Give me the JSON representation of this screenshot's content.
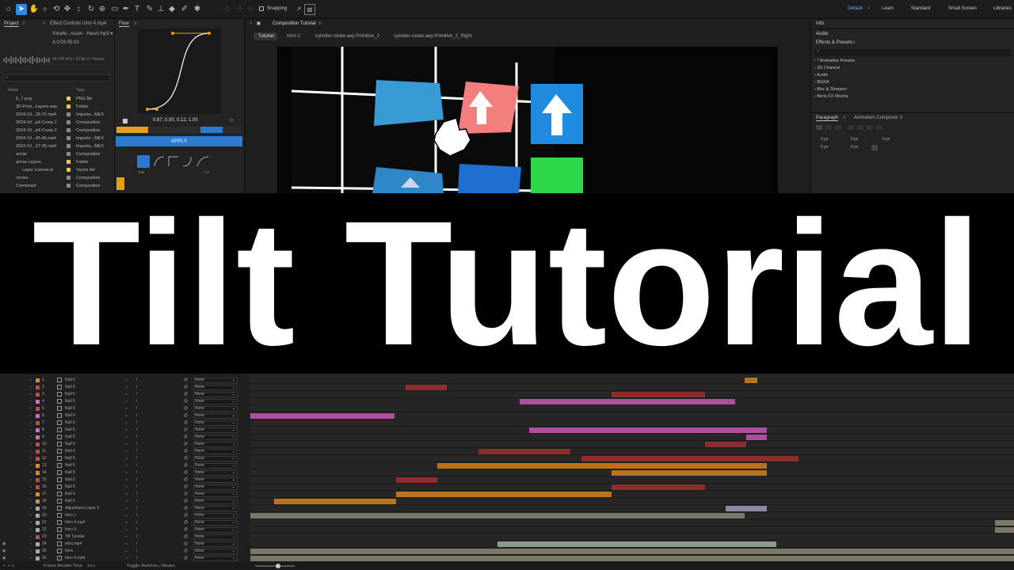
{
  "toolbar": {
    "snapping_label": "Snapping",
    "workspaces": [
      "Default",
      "Learn",
      "Standard",
      "Small Screen",
      "Libraries"
    ]
  },
  "project": {
    "tab": "Project",
    "effect_tab": "Effect Controls Intro 4.mp4",
    "file_line1": "Xxtarki...rozen - Heart.mp3 ▾",
    "file_line2": "Δ 0:03:05:03",
    "audio_info": "44,100 kHz / 32 bit U / Stereo",
    "col_name": "Name",
    "col_type": "Type",
    "items": [
      {
        "name": "5_7.png",
        "type": "PNG file",
        "color": "#e6c84a"
      },
      {
        "name": "3D-Prim...Layers.aep",
        "type": "Folder",
        "color": "#e6c84a"
      },
      {
        "name": "2024-10...38-37.mp4",
        "type": "Importe...MEX",
        "color": "#8a8a8a"
      },
      {
        "name": "2024-10...p4 Comp 1",
        "type": "Composition",
        "color": "#8a8a8a"
      },
      {
        "name": "2024-10...p4 Comp 2",
        "type": "Composition",
        "color": "#8a8a8a"
      },
      {
        "name": "2024-10...45-46.mp4",
        "type": "Importe...MEX",
        "color": "#8a8a8a"
      },
      {
        "name": "2024-10...27-35.mp4",
        "type": "Importe...MEX",
        "color": "#8a8a8a"
      },
      {
        "name": "arrow",
        "type": "Composition",
        "color": "#8a8a8a"
      },
      {
        "name": "arrow Layers",
        "type": "Folder",
        "color": "#e6c84a"
      },
      {
        "name": "Layer 1/arrow.ai",
        "type": "Vector Art",
        "color": "#e6c84a"
      },
      {
        "name": "circles",
        "type": "Composition",
        "color": "#8a8a8a"
      },
      {
        "name": "Combined",
        "type": "Composition",
        "color": "#8a8a8a"
      }
    ]
  },
  "flow": {
    "tab": "Flow",
    "values": "0.87, 0.00, 0.12, 1.00",
    "apply_label": "APPLY",
    "preset_labels": [
      "fast",
      "fast"
    ]
  },
  "composition": {
    "tab": "Composition Tutorial",
    "breadcrumbs": [
      "Tutorial",
      "Intro 2",
      "cylinder-rotate.aep.Primitive_2",
      "cylinder-rotate.aep.Primitive_2_Right"
    ]
  },
  "right": {
    "info_tab": "Info",
    "audio_tab": "Audio",
    "effects_tab": "Effects & Presets",
    "presets": [
      "* Animation Presets",
      "3D Channel",
      "Audio",
      "BGRA",
      "Blur & Sharpen",
      "Boris FX Mocha"
    ],
    "paragraph_tab": "Paragraph",
    "composer_tab": "Animation Composer 3",
    "px_values": [
      "0 px",
      "0 px",
      "0 px",
      "0 px",
      "0 px"
    ]
  },
  "title": {
    "text": "Tilt Tutorial"
  },
  "timeline": {
    "mode_default": "None",
    "layers": [
      {
        "num": "1",
        "name": "Null 6",
        "color": "#e08a2a"
      },
      {
        "num": "2",
        "name": "Null 6",
        "color": "#c84848"
      },
      {
        "num": "3",
        "name": "Null 6",
        "color": "#c84848"
      },
      {
        "num": "4",
        "name": "Null 6",
        "color": "#d868c8"
      },
      {
        "num": "5",
        "name": "Null 6",
        "color": "#c84848"
      },
      {
        "num": "6",
        "name": "Null 6",
        "color": "#d868c8"
      },
      {
        "num": "7",
        "name": "Null 6",
        "color": "#c84848"
      },
      {
        "num": "8",
        "name": "Null 6",
        "color": "#d868c8"
      },
      {
        "num": "9",
        "name": "Null 6",
        "color": "#d868c8"
      },
      {
        "num": "10",
        "name": "Null 6",
        "color": "#c84848"
      },
      {
        "num": "11",
        "name": "Null 6",
        "color": "#c84848"
      },
      {
        "num": "12",
        "name": "Null 6",
        "color": "#c84848"
      },
      {
        "num": "13",
        "name": "Null 6",
        "color": "#e08a2a"
      },
      {
        "num": "14",
        "name": "Null 6",
        "color": "#e08a2a"
      },
      {
        "num": "15",
        "name": "Null 6",
        "color": "#c84848"
      },
      {
        "num": "16",
        "name": "Null 6",
        "color": "#c84848"
      },
      {
        "num": "17",
        "name": "Null 6",
        "color": "#e08a2a"
      },
      {
        "num": "18",
        "name": "Null 6",
        "color": "#e08a2a"
      },
      {
        "num": "19",
        "name": "Adjustment Layer 3",
        "color": "#a8a8a8"
      },
      {
        "num": "20",
        "name": "Intro 1",
        "color": "#a8a8a8"
      },
      {
        "num": "21",
        "name": "Intro 4.mp4",
        "color": "#a8a8a8"
      },
      {
        "num": "22",
        "name": "Intro 3",
        "color": "#a8a8a8"
      },
      {
        "num": "23",
        "name": "Tilt Tutorial",
        "color": "#c84848"
      },
      {
        "num": "24",
        "name": "Intro.mp4",
        "color": "#a8a8a8"
      },
      {
        "num": "25",
        "name": "Intro",
        "color": "#a8a8a8"
      },
      {
        "num": "26",
        "name": "Intro 4.mp4",
        "color": "#a8a8a8"
      }
    ],
    "bar_colors": {
      "red": "#8c2e2e",
      "pink": "#b04fa0",
      "orange": "#b8741e",
      "lavender": "#8a8aa0",
      "tan": "#7c7868",
      "sage": "#8c9a8c"
    }
  },
  "status": {
    "render_label": "Frame Render Time",
    "render_value": "4ms",
    "toggle_label": "Toggle Switches / Modes"
  }
}
